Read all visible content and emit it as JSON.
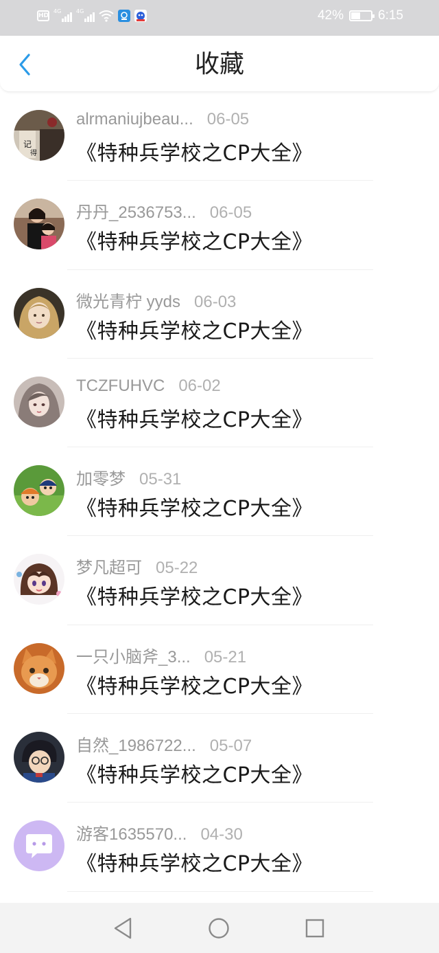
{
  "status_bar": {
    "network_hd": "HD",
    "network_labels": [
      "4G",
      "4G"
    ],
    "battery_percent": "42%",
    "battery_level": 0.42,
    "time": "6:15"
  },
  "header": {
    "title": "收藏",
    "back_icon": "chevron-left-icon",
    "accent_color": "#2b9be8"
  },
  "items": [
    {
      "name": "alrmaniujbeau...",
      "date": "06-05",
      "title": "《特种兵学校之CP大全》",
      "avatar": "book-cover-avatar"
    },
    {
      "name": "丹丹_2536753...",
      "date": "06-05",
      "title": "《特种兵学校之CP大全》",
      "avatar": "girls-photo-avatar"
    },
    {
      "name": "微光青柠 yyds",
      "date": "06-03",
      "title": "《特种兵学校之CP大全》",
      "avatar": "golden-hair-avatar"
    },
    {
      "name": "TCZFUHVC",
      "date": "06-02",
      "title": "《特种兵学校之CP大全》",
      "avatar": "anime-girl-avatar"
    },
    {
      "name": "加零梦",
      "date": "05-31",
      "title": "《特种兵学校之CP大全》",
      "avatar": "cartoon-kids-avatar"
    },
    {
      "name": "梦凡超可",
      "date": "05-22",
      "title": "《特种兵学校之CP大全》",
      "avatar": "chibi-girl-avatar"
    },
    {
      "name": "一只小脑斧_3...",
      "date": "05-21",
      "title": "《特种兵学校之CP大全》",
      "avatar": "orange-cat-avatar"
    },
    {
      "name": "自然_1986722...",
      "date": "05-07",
      "title": "《特种兵学校之CP大全》",
      "avatar": "detective-avatar"
    },
    {
      "name": "游客1635570...",
      "date": "04-30",
      "title": "《特种兵学校之CP大全》",
      "avatar": "chat-bubble-avatar"
    }
  ],
  "nav_bar": {
    "back": "triangle-back-icon",
    "home": "circle-home-icon",
    "recent": "square-recent-icon"
  }
}
